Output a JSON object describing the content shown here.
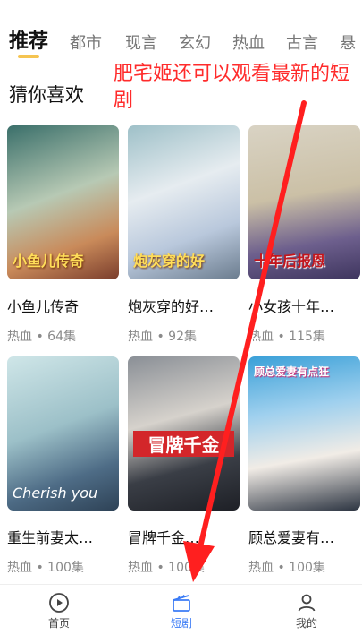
{
  "tabs": [
    "推荐",
    "都市",
    "现言",
    "玄幻",
    "热血",
    "古言",
    "悬"
  ],
  "section_title": "猜你喜欢",
  "annotation": "肥宅姬还可以观看最新的短剧",
  "cards": [
    {
      "title": "小鱼儿传奇",
      "meta": "热血 • 64集",
      "thumb_text": "小鱼儿传奇"
    },
    {
      "title": "炮灰穿的好…",
      "meta": "热血 • 92集",
      "thumb_text": "炮灰穿的好"
    },
    {
      "title": "小女孩十年…",
      "meta": "热血 • 115集",
      "thumb_text": "十年后报恩"
    },
    {
      "title": "重生前妻太…",
      "meta": "热血 • 100集",
      "thumb_text": "Cherish you"
    },
    {
      "title": "冒牌千金…",
      "meta": "热血 • 100集",
      "thumb_text": "冒牌千金"
    },
    {
      "title": "顾总爱妻有…",
      "meta": "热血 • 100集",
      "thumb_text": "顾总爱妻有点狂"
    }
  ],
  "bottom_nav": [
    {
      "label": "首页",
      "icon": "play-circle-icon"
    },
    {
      "label": "短剧",
      "icon": "clapperboard-icon"
    },
    {
      "label": "我的",
      "icon": "user-icon"
    }
  ],
  "colors": {
    "accent": "#3c7cf6",
    "annotation": "#ff2b2b",
    "tab_underline": "#f5c451"
  }
}
